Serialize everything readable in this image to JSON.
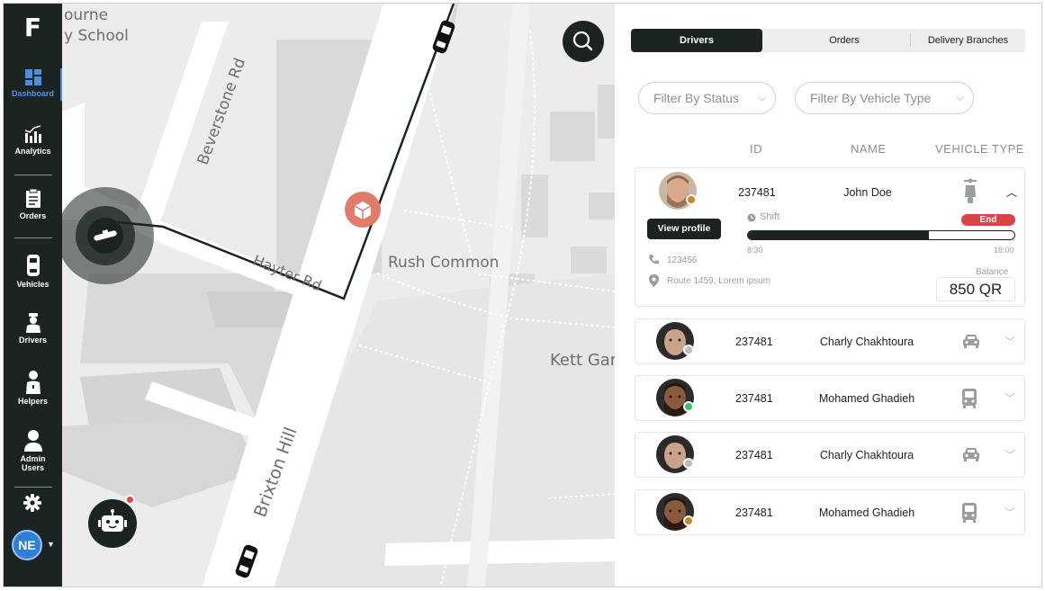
{
  "sidebar": {
    "logo": "F",
    "items": [
      {
        "label": "Dashboard",
        "icon": "dashboard-icon",
        "active": true
      },
      {
        "label": "Analytics",
        "icon": "analytics-icon"
      },
      {
        "label": "Orders",
        "icon": "orders-icon"
      },
      {
        "label": "Vehicles",
        "icon": "vehicles-icon"
      },
      {
        "label": "Drivers",
        "icon": "drivers-icon"
      },
      {
        "label": "Helpers",
        "icon": "helpers-icon"
      },
      {
        "label": "Admin Users",
        "icon": "admin-users-icon"
      }
    ],
    "settings_icon": "gear-icon",
    "user_initials": "NE",
    "active_color": "#4a90e2"
  },
  "map": {
    "labels": {
      "school_1": "ourne",
      "school_2": "y School",
      "beverstone": "Beverstone Rd",
      "hayter": "Hayter Rd",
      "rush": "Rush Common",
      "kett": "Kett Gar",
      "brixton": "Brixton Hill"
    },
    "search_icon": "search-icon",
    "assistant_icon": "robot-icon"
  },
  "panel": {
    "tabs": [
      {
        "label": "Drivers",
        "active": true
      },
      {
        "label": "Orders"
      },
      {
        "label": "Delivery Branches"
      }
    ],
    "filters": {
      "status": "Filter By Status",
      "vehicle_type": "Filter By Vehicle Type"
    },
    "columns": {
      "id": "ID",
      "name": "NAME",
      "vehicle_type": "VEHICLE TYPE"
    },
    "expanded": {
      "id": "237481",
      "name": "John Doe",
      "vehicle": "scooter-icon",
      "view_profile": "View profile",
      "shift_label": "Shift",
      "end_label": "End",
      "shift_start": "8:30",
      "shift_end": "18:00",
      "shift_progress": 0.68,
      "phone": "123456",
      "address": "Route 1459, Lorem ipsum",
      "balance_label": "Balance",
      "balance_value": "850 QR",
      "status_color": "#c8892a"
    },
    "drivers": [
      {
        "id": "237481",
        "name": "Charly Chakhtoura",
        "vehicle": "car-icon",
        "status_color": "#b9bcbc"
      },
      {
        "id": "237481",
        "name": "Mohamed Ghadieh",
        "vehicle": "bus-icon",
        "status_color": "#3fc06a"
      },
      {
        "id": "237481",
        "name": "Charly Chakhtoura",
        "vehicle": "car-icon",
        "status_color": "#b9bcbc"
      },
      {
        "id": "237481",
        "name": "Mohamed Ghadieh",
        "vehicle": "bus-icon",
        "status_color": "#c8892a"
      }
    ]
  }
}
